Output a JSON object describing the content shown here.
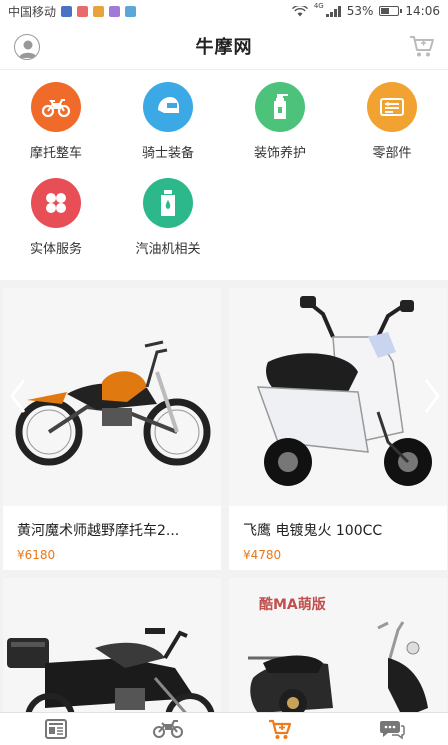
{
  "status_bar": {
    "carrier": "中国移动",
    "network": "4G",
    "battery": "53%",
    "battery_level": 0.53,
    "time": "14:06"
  },
  "header": {
    "title": "牛摩网"
  },
  "categories": [
    {
      "label": "摩托整车",
      "icon": "motorcycle-icon",
      "color": "#f06a2a"
    },
    {
      "label": "骑士装备",
      "icon": "helmet-icon",
      "color": "#3aa9e6"
    },
    {
      "label": "装饰养护",
      "icon": "spray-bottle-icon",
      "color": "#4cc27a"
    },
    {
      "label": "零部件",
      "icon": "parts-icon",
      "color": "#f2a230"
    },
    {
      "label": "实体服务",
      "icon": "service-grid-icon",
      "color": "#e84e55"
    },
    {
      "label": "汽油机相关",
      "icon": "oil-can-icon",
      "color": "#2cb88a"
    }
  ],
  "products": [
    {
      "name": "黄河魔术师越野摩托车2...",
      "price": "¥6180"
    },
    {
      "name": "飞鹰 电镀鬼火 100CC",
      "price": "¥4780"
    },
    {
      "name": "",
      "price": ""
    },
    {
      "name": "",
      "price": "",
      "promo": "酷MA萌版"
    }
  ],
  "bottom_nav": [
    {
      "name": "news-icon",
      "active": false
    },
    {
      "name": "motorcycle-icon",
      "active": false
    },
    {
      "name": "cart-icon",
      "active": true
    },
    {
      "name": "chat-icon",
      "active": false
    }
  ],
  "colors": {
    "accent": "#f07a1a",
    "price": "#e8791b"
  }
}
